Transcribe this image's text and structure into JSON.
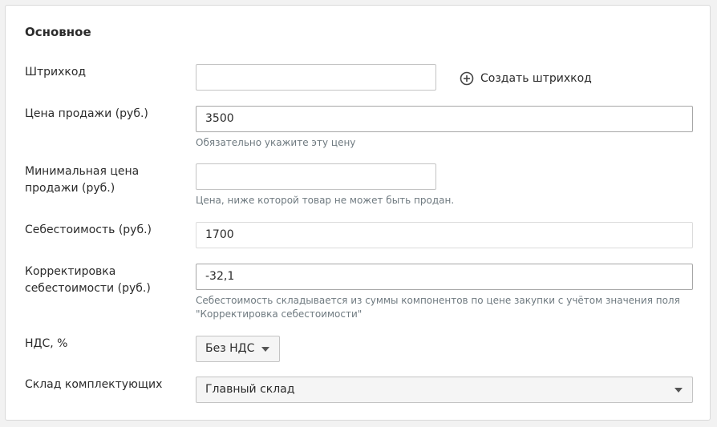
{
  "section": {
    "title": "Основное"
  },
  "fields": {
    "barcode": {
      "label": "Штрихкод",
      "value": "",
      "create_label": "Создать штрихкод"
    },
    "sale_price": {
      "label": "Цена продажи (руб.)",
      "value": "3500",
      "hint": "Обязательно укажите эту цену"
    },
    "min_price": {
      "label_line1": "Минимальная цена",
      "label_line2": "продажи (руб.)",
      "value": "",
      "hint": "Цена, ниже которой товар не может быть продан."
    },
    "cost": {
      "label": "Себестоимость (руб.)",
      "value": "1700"
    },
    "cost_adjustment": {
      "label_line1": "Корректировка",
      "label_line2": "себестоимости (руб.)",
      "value": "-32,1",
      "hint_line1": "Себестоимость складывается из суммы компонентов по цене закупки с учётом значения поля",
      "hint_line2": "\"Корректировка себестоимости\""
    },
    "vat": {
      "label": "НДС, %",
      "selected": "Без НДС"
    },
    "warehouse": {
      "label": "Склад комплектующих",
      "selected": "Главный склад"
    }
  },
  "icons": {
    "create": "plus-circle-icon",
    "dropdown": "caret-down-icon"
  }
}
